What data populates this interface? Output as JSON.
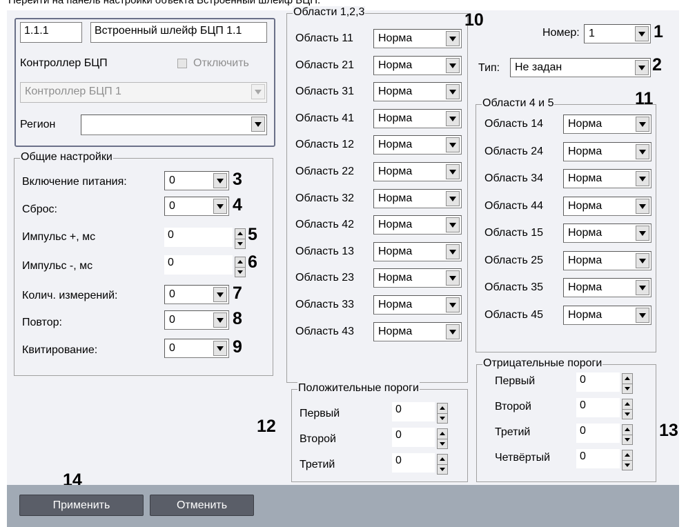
{
  "top_caption": "Перейти на панель настройки объекта Встроенный шлейф БЦП.",
  "header": {
    "id_value": "1.1.1",
    "name_value": "Встроенный шлейф БЦП 1.1",
    "controller_label": "Контроллер БЦП",
    "disable_label": "Отключить",
    "controller_value": "Контроллер БЦП 1",
    "region_label": "Регион",
    "region_value": ""
  },
  "general": {
    "title": "Общие настройки",
    "rows": [
      {
        "label": "Включение питания:",
        "value": "0",
        "callout": "3"
      },
      {
        "label": "Сброс:",
        "value": "0",
        "callout": "4"
      },
      {
        "label": "Импульс +, мс",
        "value": "0",
        "callout": "5"
      },
      {
        "label": "Импульс -, мс",
        "value": "0",
        "callout": "6"
      },
      {
        "label": "Колич. измерений:",
        "value": "0",
        "callout": "7"
      },
      {
        "label": "Повтор:",
        "value": "0",
        "callout": "8"
      },
      {
        "label": "Квитирование:",
        "value": "0",
        "callout": "9"
      }
    ]
  },
  "areas123": {
    "title": "Области 1,2,3",
    "callout": "10",
    "rows": [
      {
        "label": "Область 11",
        "value": "Норма"
      },
      {
        "label": "Область 21",
        "value": "Норма"
      },
      {
        "label": "Область 31",
        "value": "Норма"
      },
      {
        "label": "Область 41",
        "value": "Норма"
      },
      {
        "label": "Область 12",
        "value": "Норма"
      },
      {
        "label": "Область 22",
        "value": "Норма"
      },
      {
        "label": "Область 32",
        "value": "Норма"
      },
      {
        "label": "Область 42",
        "value": "Норма"
      },
      {
        "label": "Область 13",
        "value": "Норма"
      },
      {
        "label": "Область 23",
        "value": "Норма"
      },
      {
        "label": "Область 33",
        "value": "Норма"
      },
      {
        "label": "Область 43",
        "value": "Норма"
      }
    ]
  },
  "number": {
    "label": "Номер:",
    "value": "1",
    "callout": "1"
  },
  "type": {
    "label": "Тип:",
    "value": "Не задан",
    "callout": "2"
  },
  "areas45": {
    "title": "Области 4 и 5",
    "callout": "11",
    "rows": [
      {
        "label": "Область 14",
        "value": "Норма"
      },
      {
        "label": "Область 24",
        "value": "Норма"
      },
      {
        "label": "Область 34",
        "value": "Норма"
      },
      {
        "label": "Область 44",
        "value": "Норма"
      },
      {
        "label": "Область 15",
        "value": "Норма"
      },
      {
        "label": "Область 25",
        "value": "Норма"
      },
      {
        "label": "Область 35",
        "value": "Норма"
      },
      {
        "label": "Область 45",
        "value": "Норма"
      }
    ]
  },
  "positive": {
    "title": "Положительные пороги",
    "callout": "12",
    "rows": [
      {
        "label": "Первый",
        "value": "0"
      },
      {
        "label": "Второй",
        "value": "0"
      },
      {
        "label": "Третий",
        "value": "0"
      }
    ]
  },
  "negative": {
    "title": "Отрицательные пороги",
    "callout": "13",
    "rows": [
      {
        "label": "Первый",
        "value": "0"
      },
      {
        "label": "Второй",
        "value": "0"
      },
      {
        "label": "Третий",
        "value": "0"
      },
      {
        "label": "Четвёртый",
        "value": "0"
      }
    ]
  },
  "footer": {
    "apply_label": "Применить",
    "cancel_label": "Отменить",
    "callout": "14"
  }
}
